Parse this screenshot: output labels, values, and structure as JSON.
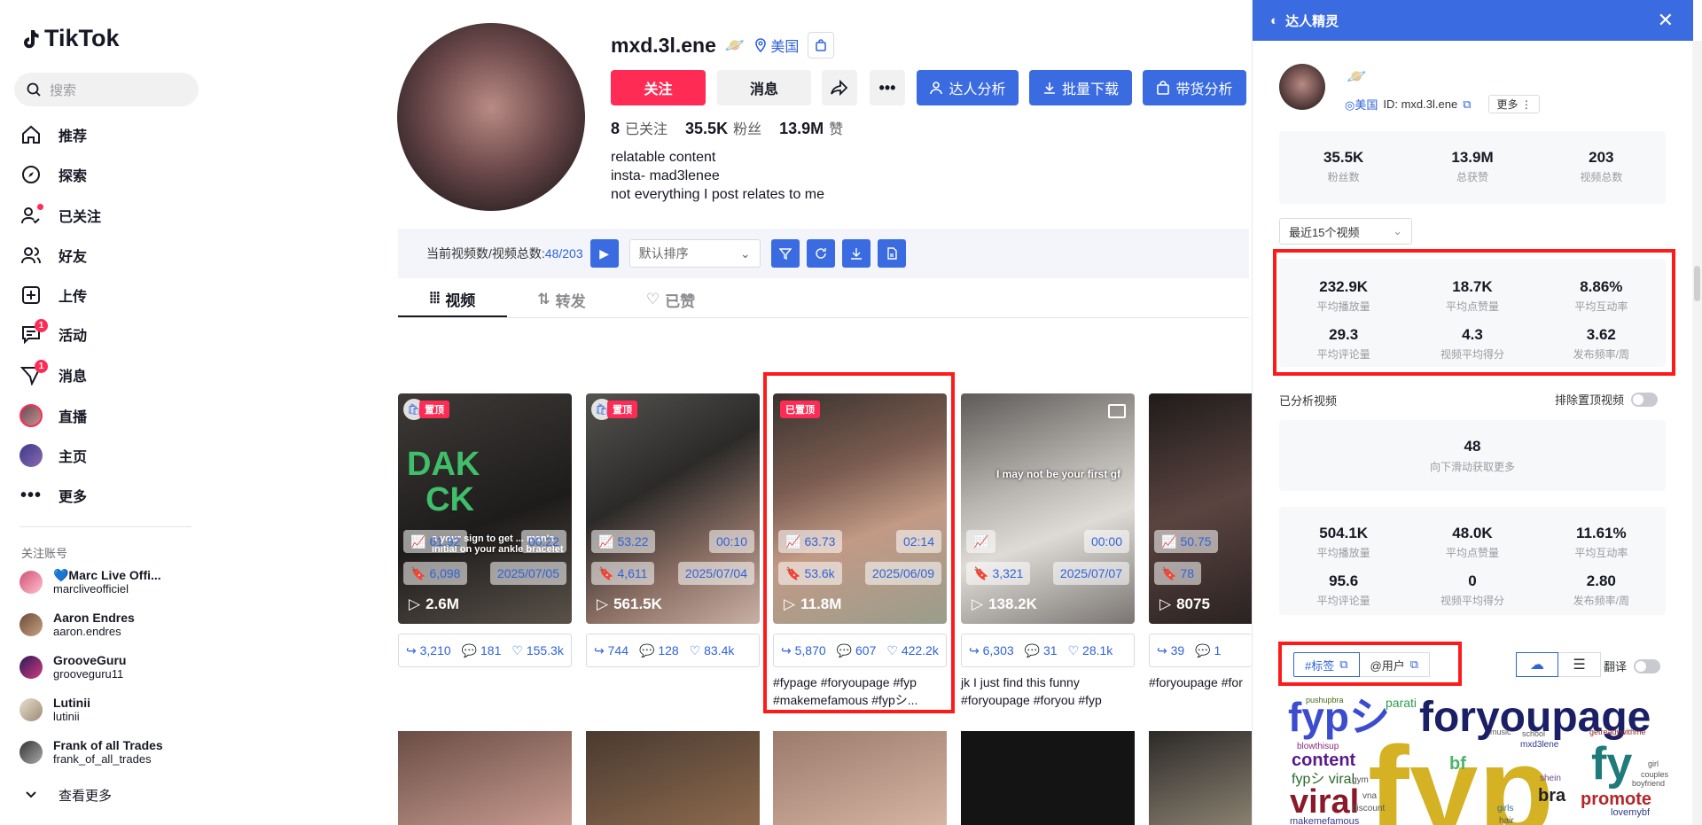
{
  "app": {
    "logo": "TikTok"
  },
  "sidebar": {
    "search_placeholder": "搜索",
    "nav": [
      {
        "label": "推荐",
        "icon": "home-icon"
      },
      {
        "label": "探索",
        "icon": "compass-icon"
      },
      {
        "label": "已关注",
        "icon": "user-follow-icon"
      },
      {
        "label": "好友",
        "icon": "friends-icon"
      },
      {
        "label": "上传",
        "icon": "upload-icon"
      },
      {
        "label": "活动",
        "icon": "activity-icon",
        "badge": "1"
      },
      {
        "label": "消息",
        "icon": "message-icon",
        "badge": "1"
      },
      {
        "label": "直播",
        "icon": "live-icon"
      },
      {
        "label": "主页",
        "icon": "profile-icon"
      },
      {
        "label": "更多",
        "icon": "more-icon"
      }
    ],
    "following_title": "关注账号",
    "following": [
      {
        "name": "💙Marc Live Offi...",
        "handle": "marcliveofficiel"
      },
      {
        "name": "Aaron Endres",
        "handle": "aaron.endres"
      },
      {
        "name": "GrooveGuru",
        "handle": "grooveguru11"
      },
      {
        "name": "Lutinii",
        "handle": "lutinii"
      },
      {
        "name": "Frank of all Trades",
        "handle": "frank_of_all_trades"
      }
    ],
    "see_more": "查看更多"
  },
  "profile": {
    "username": "mxd.3l.ene",
    "location": "美国",
    "follow_label": "关注",
    "message_label": "消息",
    "analysis_label": "达人分析",
    "download_label": "批量下载",
    "commerce_label": "带货分析",
    "following_count": "8",
    "following_label": "已关注",
    "followers_count": "35.5K",
    "followers_label": "粉丝",
    "likes_count": "13.9M",
    "likes_label": "赞",
    "bio": [
      "relatable content",
      "insta- mad3lenee",
      "not everything I post relates to me"
    ]
  },
  "toolbar": {
    "count_label": "当前视频数/视频总数:",
    "count_value": "48/203",
    "sort_value": "默认排序"
  },
  "tabs": [
    {
      "label": "视频"
    },
    {
      "label": "转发"
    },
    {
      "label": "已赞"
    }
  ],
  "videos": [
    {
      "pin": "置顶",
      "score": "61.92",
      "duration": "00:22",
      "saves": "6,098",
      "date": "2025/07/05",
      "views": "2.6M",
      "shares": "3,210",
      "comments": "181",
      "likes": "155.3k",
      "desc": "",
      "overlay": "s your sign to get ... man's initial on your ankle bracelet"
    },
    {
      "pin": "置顶",
      "score": "53.22",
      "duration": "00:10",
      "saves": "4,611",
      "date": "2025/07/04",
      "views": "561.5K",
      "shares": "744",
      "comments": "128",
      "likes": "83.4k",
      "desc": ""
    },
    {
      "pin": "已置顶",
      "score": "63.73",
      "duration": "02:14",
      "saves": "53.6k",
      "date": "2025/06/09",
      "views": "11.8M",
      "shares": "5,870",
      "comments": "607",
      "likes": "422.2k",
      "desc": "#fypage #foryoupage #fyp #makemefamous #fypシ..."
    },
    {
      "pin": "",
      "score": "",
      "duration": "00:00",
      "saves": "3,321",
      "date": "2025/07/07",
      "views": "138.2K",
      "shares": "6,303",
      "comments": "31",
      "likes": "28.1k",
      "desc": "jk I just find this funny #foryoupage #foryou #fyp",
      "overlay": "I may not be your first gf"
    },
    {
      "pin": "",
      "score": "50.75",
      "duration": "",
      "saves": "78",
      "date": "",
      "views": "8075",
      "shares": "39",
      "comments": "1",
      "likes": "",
      "desc": "#foryoupage #for"
    }
  ],
  "panel": {
    "title": "达人精灵",
    "location": "美国",
    "id_label": "ID: mxd.3l.ene",
    "more_label": "更多",
    "summary": [
      {
        "v": "35.5K",
        "l": "粉丝数"
      },
      {
        "v": "13.9M",
        "l": "总获赞"
      },
      {
        "v": "203",
        "l": "视频总数"
      }
    ],
    "range_select": "最近15个视频",
    "recent_stats": [
      {
        "v": "232.9K",
        "l": "平均播放量"
      },
      {
        "v": "18.7K",
        "l": "平均点赞量"
      },
      {
        "v": "8.86%",
        "l": "平均互动率"
      },
      {
        "v": "29.3",
        "l": "平均评论量"
      },
      {
        "v": "4.3",
        "l": "视频平均得分"
      },
      {
        "v": "3.62",
        "l": "发布频率/周"
      }
    ],
    "analyzed_label": "已分析视频",
    "exclude_pinned_label": "排除置顶视频",
    "analyzed_count": "48",
    "scroll_hint": "向下滑动获取更多",
    "all_stats": [
      {
        "v": "504.1K",
        "l": "平均播放量"
      },
      {
        "v": "48.0K",
        "l": "平均点赞量"
      },
      {
        "v": "11.61%",
        "l": "平均互动率"
      },
      {
        "v": "95.6",
        "l": "平均评论量"
      },
      {
        "v": "0",
        "l": "视频平均得分"
      },
      {
        "v": "2.80",
        "l": "发布频率/周"
      }
    ],
    "tag_tab": "#标签",
    "user_tab": "@用户",
    "translate_label": "翻译",
    "wordcloud": [
      "fypシ",
      "foryoupage",
      "fyp",
      "fy",
      "viral",
      "content",
      "parati",
      "pushupbra",
      "bf",
      "bra",
      "promote",
      "shein",
      "fypシ viral",
      "blowthisup",
      "mxd3lene",
      "girl",
      "couples",
      "boyfriend",
      "gym",
      "vna",
      "discount",
      "girls",
      "hair",
      "makemefamous",
      "getreadywithme",
      "school",
      "music",
      "lovemybf"
    ]
  },
  "colors": {
    "accent": "#fe2c55",
    "brand_blue": "#3a6be0",
    "highlight": "#ff1a1a"
  }
}
